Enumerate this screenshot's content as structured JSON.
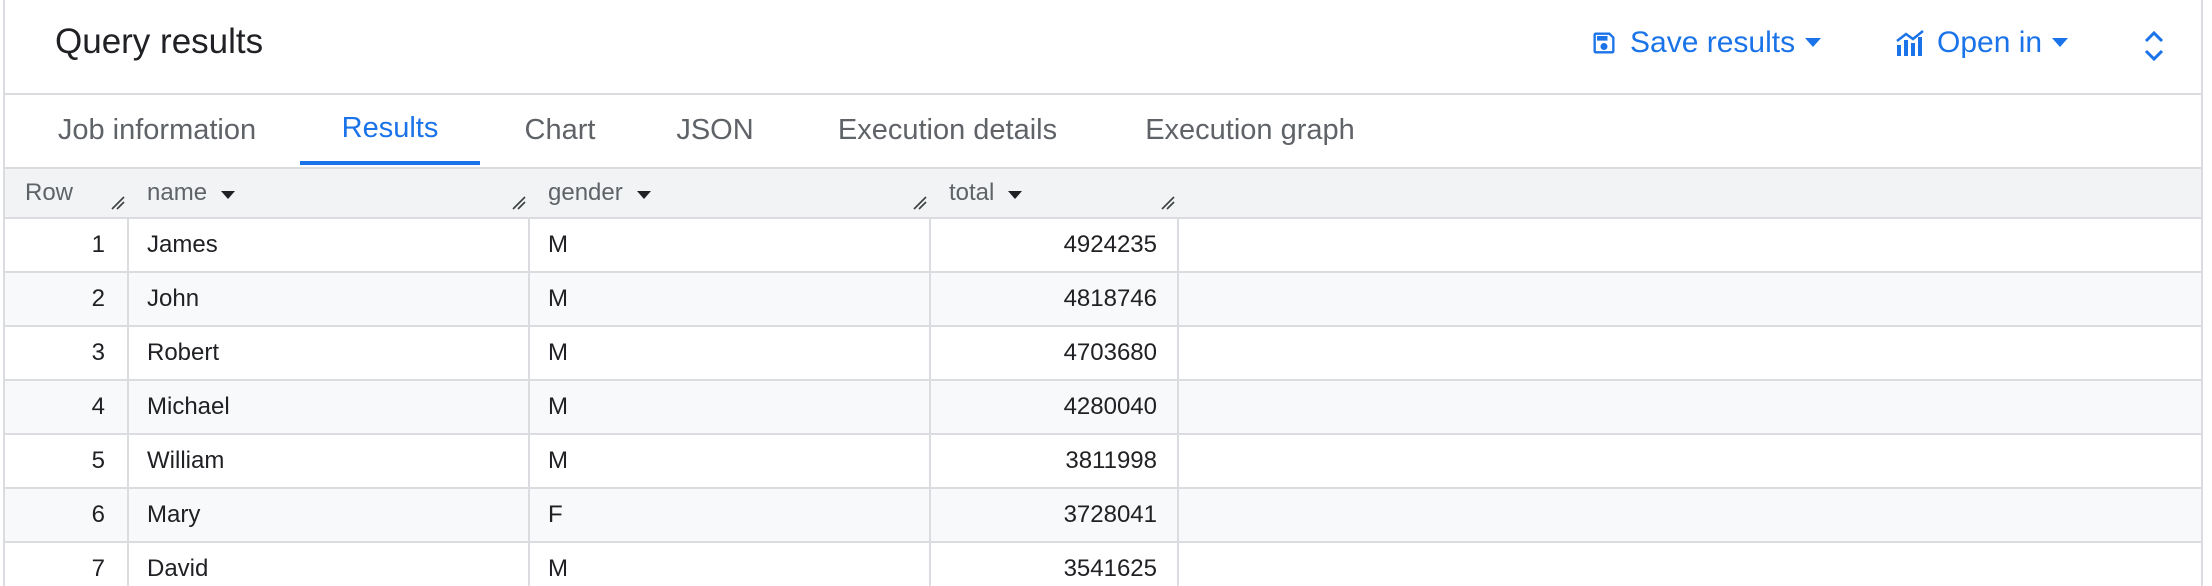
{
  "header": {
    "title": "Query results",
    "save_results_label": "Save results",
    "open_in_label": "Open in"
  },
  "tabs": [
    {
      "label": "Job information",
      "active": false
    },
    {
      "label": "Results",
      "active": true
    },
    {
      "label": "Chart",
      "active": false
    },
    {
      "label": "JSON",
      "active": false
    },
    {
      "label": "Execution details",
      "active": false
    },
    {
      "label": "Execution graph",
      "active": false
    }
  ],
  "table": {
    "columns": [
      "Row",
      "name",
      "gender",
      "total"
    ],
    "rows": [
      {
        "row": "1",
        "name": "James",
        "gender": "M",
        "total": "4924235"
      },
      {
        "row": "2",
        "name": "John",
        "gender": "M",
        "total": "4818746"
      },
      {
        "row": "3",
        "name": "Robert",
        "gender": "M",
        "total": "4703680"
      },
      {
        "row": "4",
        "name": "Michael",
        "gender": "M",
        "total": "4280040"
      },
      {
        "row": "5",
        "name": "William",
        "gender": "M",
        "total": "3811998"
      },
      {
        "row": "6",
        "name": "Mary",
        "gender": "F",
        "total": "3728041"
      },
      {
        "row": "7",
        "name": "David",
        "gender": "M",
        "total": "3541625"
      }
    ]
  },
  "colors": {
    "accent": "#1a73e8",
    "border": "#dadce0",
    "header_bg": "#f1f3f4",
    "alt_row_bg": "#f8f9fa"
  },
  "icons": [
    "save-icon",
    "caret-down-icon",
    "chart-icon",
    "expand-icon",
    "sort-icon",
    "resize-handle-icon"
  ]
}
